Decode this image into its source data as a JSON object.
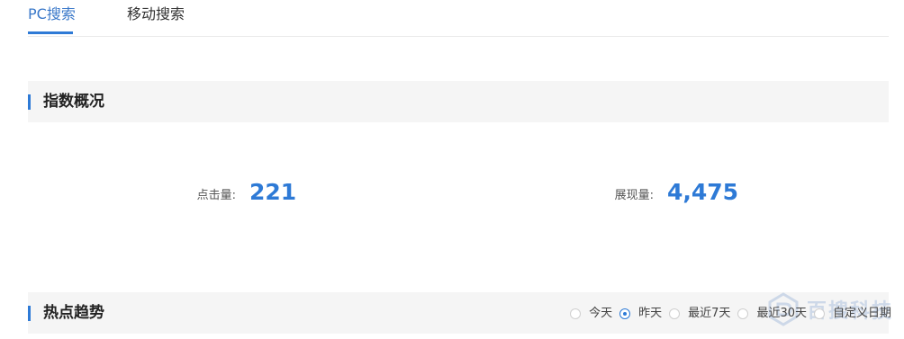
{
  "tabs": [
    {
      "label": "PC搜索",
      "active": true
    },
    {
      "label": "移动搜索",
      "active": false
    }
  ],
  "overview": {
    "title": "指数概况",
    "stats": [
      {
        "label": "点击量:",
        "value": "221"
      },
      {
        "label": "展现量:",
        "value": "4,475"
      }
    ]
  },
  "trend": {
    "title": "热点趋势",
    "date_options": [
      {
        "label": "今天",
        "checked": false
      },
      {
        "label": "昨天",
        "checked": true
      },
      {
        "label": "最近7天",
        "checked": false
      },
      {
        "label": "最近30天",
        "checked": false
      },
      {
        "label": "自定义日期",
        "checked": false
      }
    ]
  },
  "watermark": {
    "text": "百搜科技"
  },
  "colors": {
    "accent": "#2e7ad6",
    "active_tab_text": "#3a78c9",
    "section_bg": "#f5f5f5"
  }
}
